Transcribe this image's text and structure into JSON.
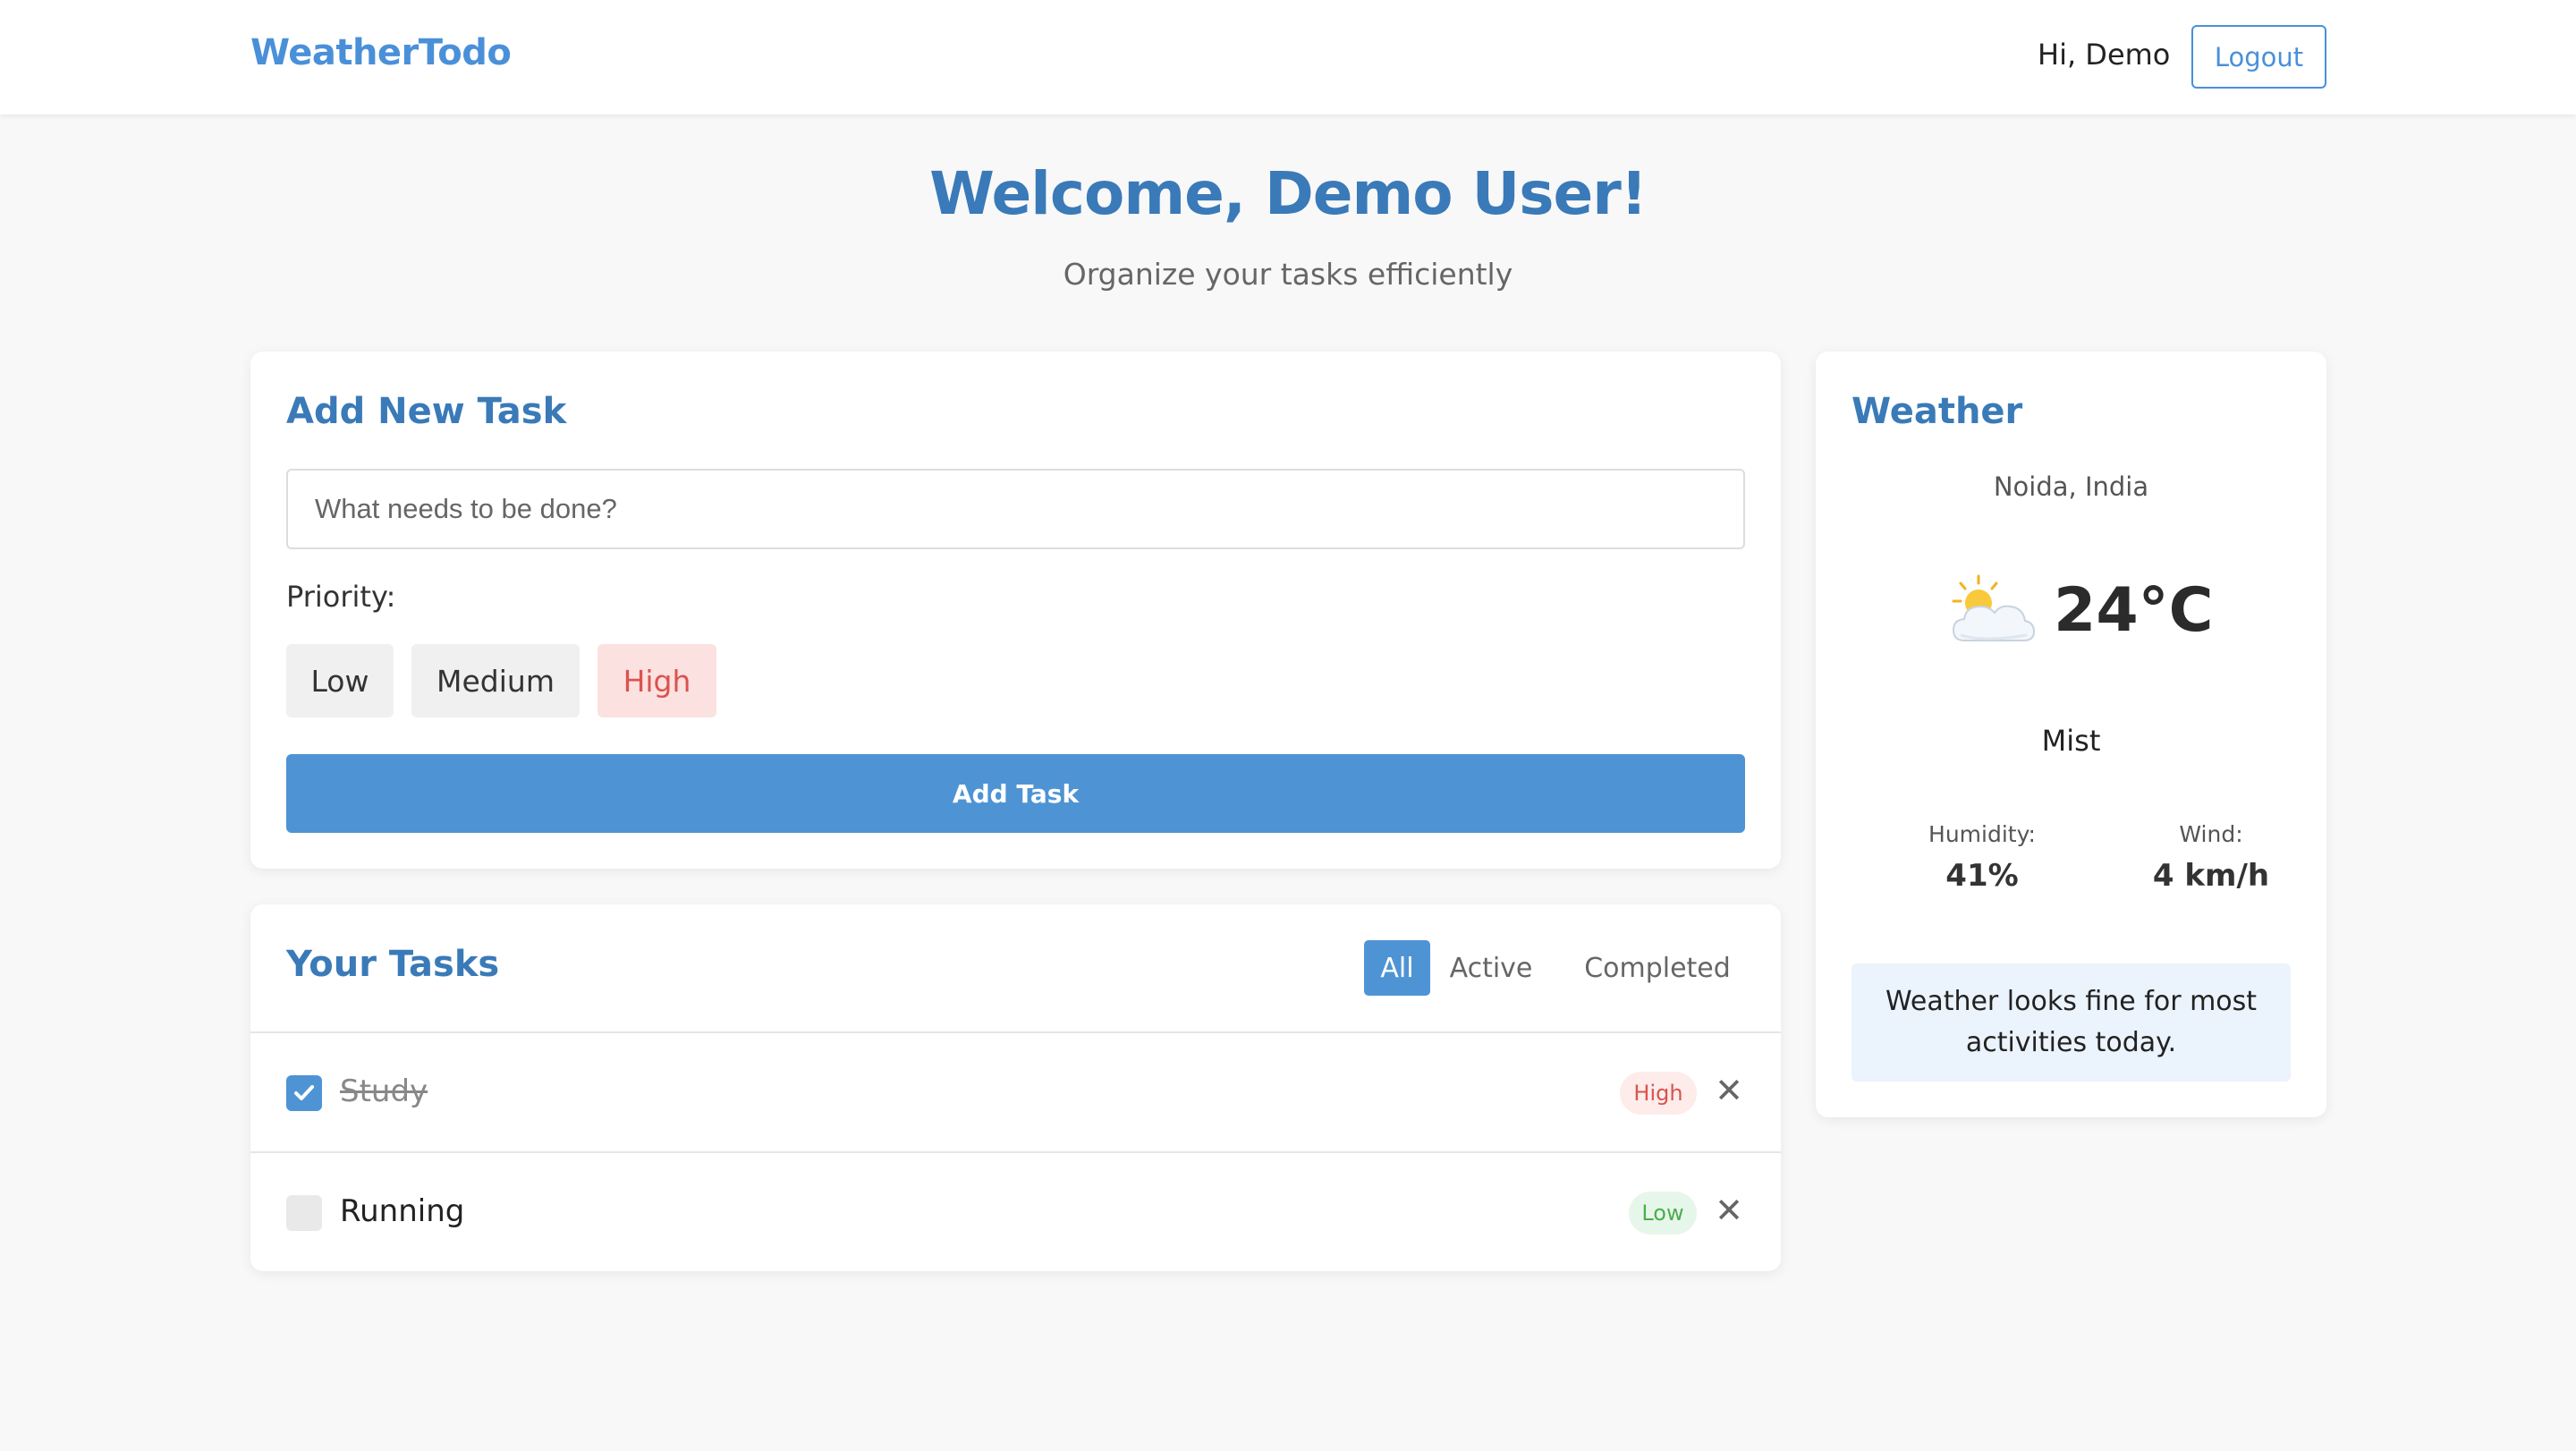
{
  "header": {
    "brand": "WeatherTodo",
    "greeting": "Hi, Demo",
    "logout_label": "Logout"
  },
  "hero": {
    "title": "Welcome, Demo User!",
    "subtitle": "Organize your tasks efficiently"
  },
  "add_task": {
    "title": "Add New Task",
    "input_placeholder": "What needs to be done?",
    "input_value": "",
    "priority_label": "Priority:",
    "priorities": [
      "Low",
      "Medium",
      "High"
    ],
    "selected_priority": "High",
    "submit_label": "Add Task"
  },
  "tasks": {
    "title": "Your Tasks",
    "filters": [
      "All",
      "Active",
      "Completed"
    ],
    "active_filter": "All",
    "items": [
      {
        "text": "Study",
        "completed": true,
        "priority": "High"
      },
      {
        "text": "Running",
        "completed": false,
        "priority": "Low"
      }
    ],
    "delete_glyph": "✕"
  },
  "weather": {
    "title": "Weather",
    "location": "Noida, India",
    "icon": "sun-behind-cloud-icon",
    "temperature": "24°C",
    "condition": "Mist",
    "humidity_label": "Humidity:",
    "humidity_value": "41%",
    "wind_label": "Wind:",
    "wind_value": "4 km/h",
    "advice": "Weather looks fine for most activities today."
  },
  "colors": {
    "brand": "#4a90d9",
    "heading": "#3a7ab8",
    "primary_button": "#4e94d4",
    "priority_high": "#d9534f",
    "priority_low": "#4cae4c"
  }
}
